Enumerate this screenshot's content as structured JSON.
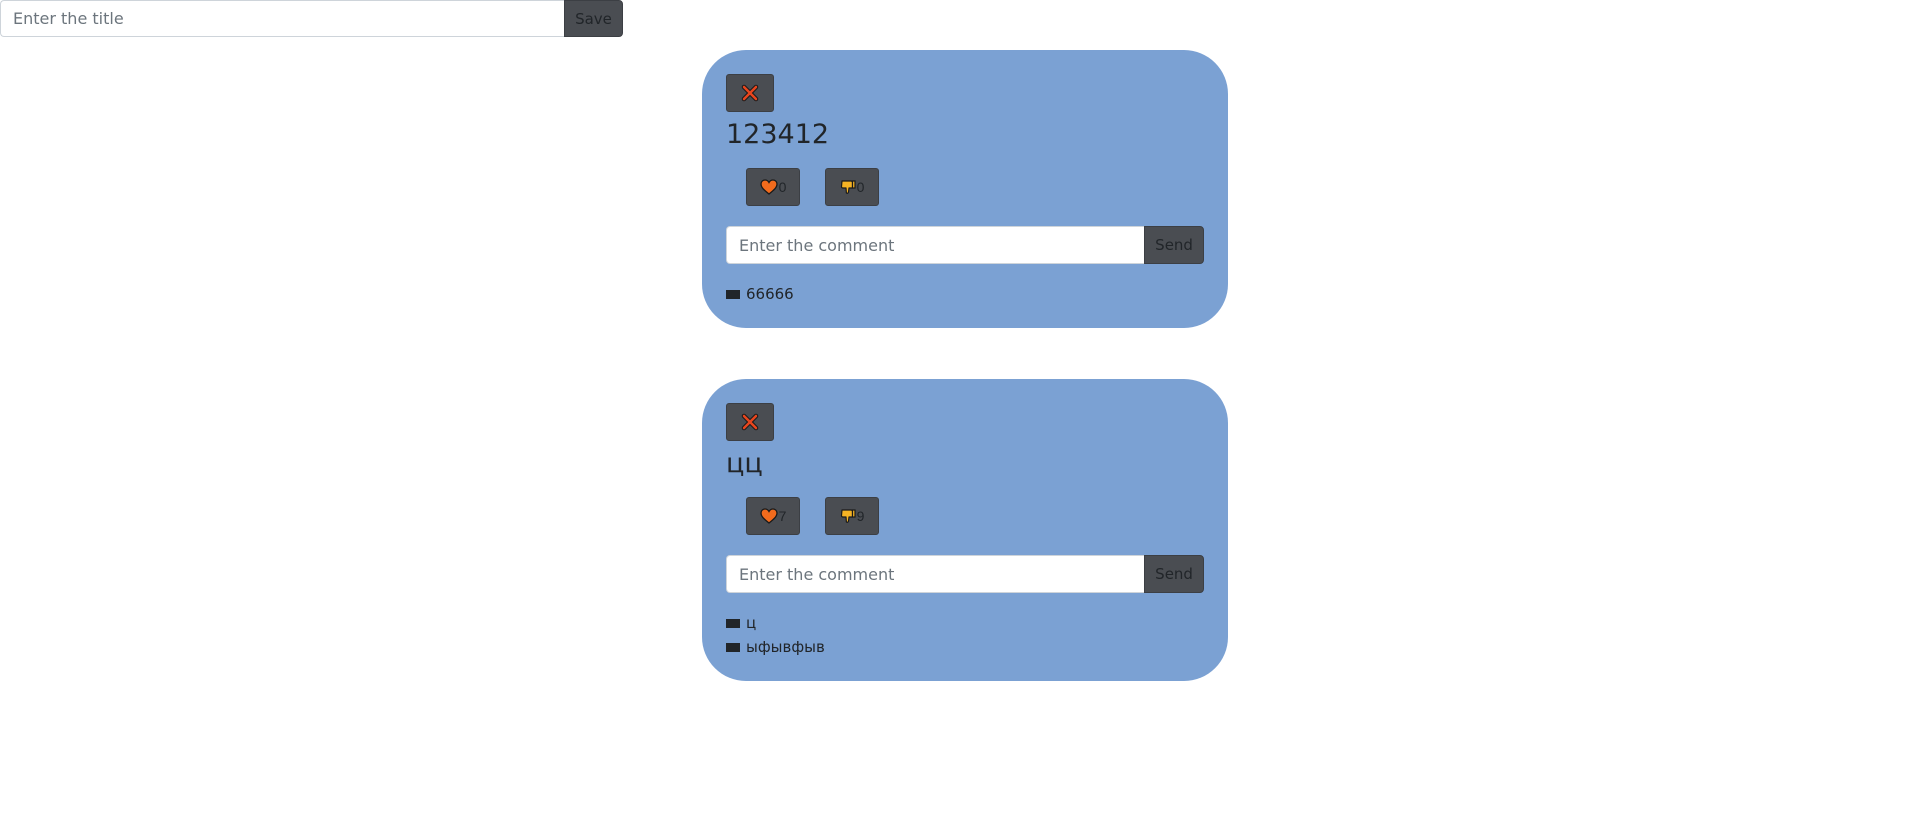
{
  "title_form": {
    "placeholder": "Enter the title",
    "save_label": "Save"
  },
  "icons": {
    "delete": "close-icon",
    "like": "heart-icon",
    "dislike": "thumbs-down-icon",
    "comment": "comment-marker-icon"
  },
  "colors": {
    "card_background": "#7ba1d3",
    "button_background": "#4a4d52",
    "heart": "#f26b1d",
    "thumbs_down": "#f5b324",
    "delete_x": "#e8461e"
  },
  "posts": [
    {
      "title": "123412",
      "likes": "0",
      "dislikes": "0",
      "comment_placeholder": "Enter the comment",
      "send_label": "Send",
      "comments": [
        "66666"
      ]
    },
    {
      "title": "цц",
      "likes": "7",
      "dislikes": "9",
      "comment_placeholder": "Enter the comment",
      "send_label": "Send",
      "comments": [
        "ц",
        "ыфывфыв"
      ]
    }
  ]
}
